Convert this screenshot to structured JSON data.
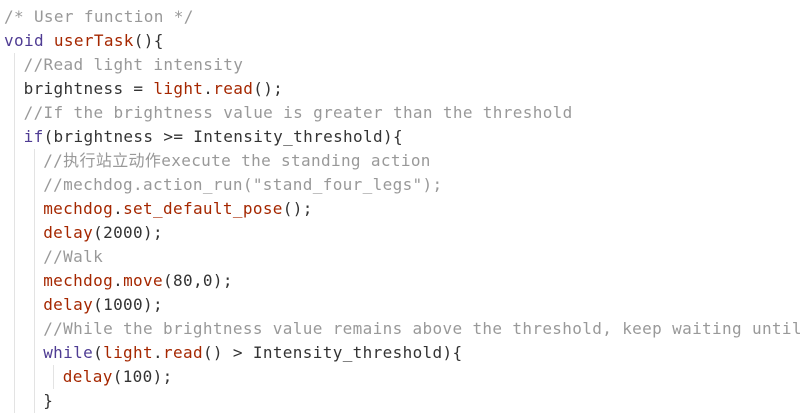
{
  "editor": {
    "language": "Arduino C++",
    "colors": {
      "background": "#ffffff",
      "comment": "#999999",
      "keyword": "#4f3c93",
      "function": "#a52700",
      "text": "#333333",
      "indent_guide": "#e3e3e3"
    },
    "lines": [
      {
        "indent": 0,
        "tokens": [
          {
            "t": "/* User function */",
            "c": "comment"
          }
        ]
      },
      {
        "indent": 0,
        "tokens": [
          {
            "t": "void ",
            "c": "keyword"
          },
          {
            "t": "userTask",
            "c": "func"
          },
          {
            "t": "(){",
            "c": "plain"
          }
        ]
      },
      {
        "indent": 1,
        "tokens": [
          {
            "t": "//Read light intensity",
            "c": "comment"
          }
        ]
      },
      {
        "indent": 1,
        "tokens": [
          {
            "t": "brightness = ",
            "c": "plain"
          },
          {
            "t": "light",
            "c": "obj"
          },
          {
            "t": ".",
            "c": "plain"
          },
          {
            "t": "read",
            "c": "func"
          },
          {
            "t": "();",
            "c": "plain"
          }
        ]
      },
      {
        "indent": 1,
        "tokens": [
          {
            "t": "//If the brightness value is greater than the threshold",
            "c": "comment"
          }
        ]
      },
      {
        "indent": 1,
        "tokens": [
          {
            "t": "if",
            "c": "keyword"
          },
          {
            "t": "(brightness >= Intensity_threshold){",
            "c": "plain"
          }
        ]
      },
      {
        "indent": 2,
        "tokens": [
          {
            "t": "//执行站立动作execute the standing action",
            "c": "comment"
          }
        ]
      },
      {
        "indent": 2,
        "tokens": [
          {
            "t": "//mechdog.action_run(\"stand_four_legs\");",
            "c": "comment"
          }
        ]
      },
      {
        "indent": 2,
        "tokens": [
          {
            "t": "mechdog",
            "c": "obj"
          },
          {
            "t": ".",
            "c": "plain"
          },
          {
            "t": "set_default_pose",
            "c": "func"
          },
          {
            "t": "();",
            "c": "plain"
          }
        ]
      },
      {
        "indent": 2,
        "tokens": [
          {
            "t": "delay",
            "c": "func"
          },
          {
            "t": "(2000);",
            "c": "plain"
          }
        ]
      },
      {
        "indent": 2,
        "tokens": [
          {
            "t": "//Walk",
            "c": "comment"
          }
        ]
      },
      {
        "indent": 2,
        "tokens": [
          {
            "t": "mechdog",
            "c": "obj"
          },
          {
            "t": ".",
            "c": "plain"
          },
          {
            "t": "move",
            "c": "func"
          },
          {
            "t": "(80,0);",
            "c": "plain"
          }
        ]
      },
      {
        "indent": 2,
        "tokens": [
          {
            "t": "delay",
            "c": "func"
          },
          {
            "t": "(1000);",
            "c": "plain"
          }
        ]
      },
      {
        "indent": 2,
        "tokens": [
          {
            "t": "//While the brightness value remains above the threshold, keep waiting until",
            "c": "comment"
          }
        ]
      },
      {
        "indent": 2,
        "tokens": [
          {
            "t": "while",
            "c": "keyword"
          },
          {
            "t": "(",
            "c": "plain"
          },
          {
            "t": "light",
            "c": "obj"
          },
          {
            "t": ".",
            "c": "plain"
          },
          {
            "t": "read",
            "c": "func"
          },
          {
            "t": "() > Intensity_threshold){",
            "c": "plain"
          }
        ]
      },
      {
        "indent": 3,
        "tokens": [
          {
            "t": "delay",
            "c": "func"
          },
          {
            "t": "(100);",
            "c": "plain"
          }
        ]
      },
      {
        "indent": 2,
        "tokens": [
          {
            "t": "}",
            "c": "plain"
          }
        ]
      }
    ]
  }
}
